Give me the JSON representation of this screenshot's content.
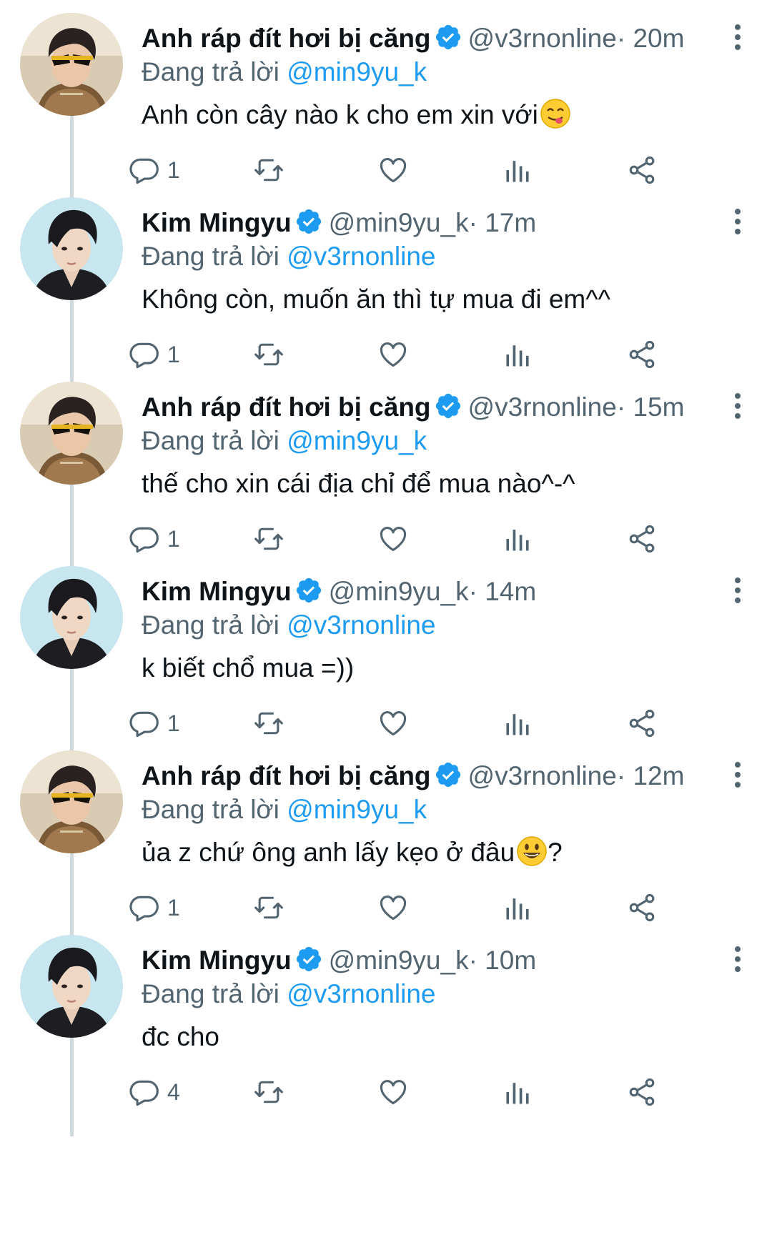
{
  "tweets": [
    {
      "author": "Anh ráp đít hơi bị căng",
      "handle": "@v3rnonline",
      "time": "20m",
      "replying_prefix": "Đang trả lời",
      "replying_to": "@min9yu_k",
      "text": "Anh còn cây nào k cho em xin với",
      "emoji": "yum-emoji",
      "replies": "1",
      "avatar": "vernon-avatar"
    },
    {
      "author": "Kim Mingyu",
      "handle": "@min9yu_k",
      "time": "17m",
      "replying_prefix": "Đang trả lời",
      "replying_to": "@v3rnonline",
      "text": "Không còn, muốn ăn thì tự mua đi em^^",
      "emoji": "",
      "replies": "1",
      "avatar": "mingyu-avatar"
    },
    {
      "author": "Anh ráp đít hơi bị căng",
      "handle": "@v3rnonline",
      "time": "15m",
      "replying_prefix": "Đang trả lời",
      "replying_to": "@min9yu_k",
      "text": "thế cho xin cái địa chỉ để mua nào^-^",
      "emoji": "",
      "replies": "1",
      "avatar": "vernon-avatar"
    },
    {
      "author": "Kim Mingyu",
      "handle": "@min9yu_k",
      "time": "14m",
      "replying_prefix": "Đang trả lời",
      "replying_to": "@v3rnonline",
      "text": "k biết chổ mua =))",
      "emoji": "",
      "replies": "1",
      "avatar": "mingyu-avatar"
    },
    {
      "author": "Anh ráp đít hơi bị căng",
      "handle": "@v3rnonline",
      "time": "12m",
      "replying_prefix": "Đang trả lời",
      "replying_to": "@min9yu_k",
      "text": "ủa z chứ ông anh lấy kẹo ở đâu",
      "text_suffix": "?",
      "emoji": "smiley-emoji",
      "replies": "1",
      "avatar": "vernon-avatar"
    },
    {
      "author": "Kim Mingyu",
      "handle": "@min9yu_k",
      "time": "10m",
      "replying_prefix": "Đang trả lời",
      "replying_to": "@v3rnonline",
      "text": "đc cho",
      "emoji": "",
      "replies": "4",
      "avatar": "mingyu-avatar"
    }
  ],
  "separator": "·",
  "colors": {
    "text": "#0f1419",
    "secondary": "#536471",
    "accent": "#1d9bf0",
    "thread_line": "#cfd9de"
  },
  "icons": [
    "verified-badge-icon",
    "more-icon",
    "reply-icon",
    "retweet-icon",
    "like-icon",
    "analytics-icon",
    "share-icon"
  ]
}
